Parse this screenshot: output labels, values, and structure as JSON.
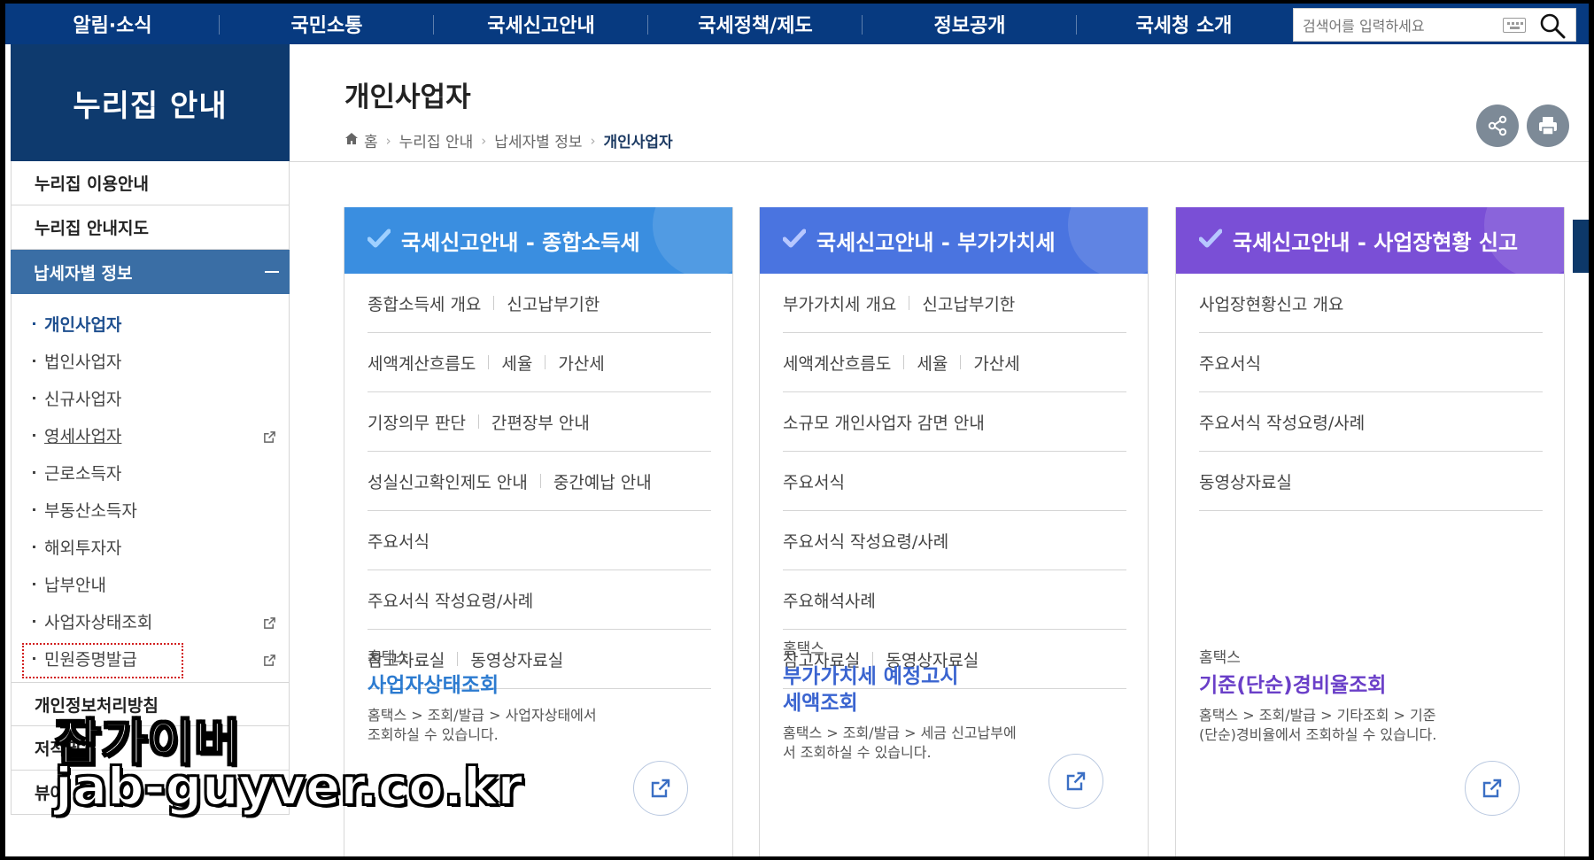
{
  "nav": {
    "items": [
      "알림·소식",
      "국민소통",
      "국세신고안내",
      "국세정책/제도",
      "정보공개",
      "국세청 소개"
    ],
    "search_placeholder": "검색어를 입력하세요"
  },
  "sidebar": {
    "title": "누리집 안내",
    "top_links": [
      "누리집 이용안내",
      "누리집 안내지도"
    ],
    "active": "납세자별 정보",
    "sub_items": [
      {
        "label": "개인사업자"
      },
      {
        "label": "법인사업자"
      },
      {
        "label": "신규사업자"
      },
      {
        "label": "영세사업자"
      },
      {
        "label": "근로소득자"
      },
      {
        "label": "부동산소득자"
      },
      {
        "label": "해외투자자"
      },
      {
        "label": "납부안내"
      },
      {
        "label": "사업자상태조회"
      },
      {
        "label": "민원증명발급"
      }
    ],
    "bottom_links": [
      "개인정보처리방침",
      "저작권",
      "뷰어"
    ]
  },
  "page": {
    "title": "개인사업자",
    "breadcrumb": [
      "홈",
      "누리집 안내",
      "납세자별 정보",
      "개인사업자"
    ]
  },
  "cards": [
    {
      "title": "국세신고안내 - 종합소득세",
      "color": "#3a8ee0",
      "rows": [
        [
          "종합소득세 개요",
          "신고납부기한"
        ],
        [
          "세액계산흐름도",
          "세율",
          "가산세"
        ],
        [
          "기장의무 판단",
          "간편장부 안내"
        ],
        [
          "성실신고확인제도 안내",
          "중간예납 안내"
        ],
        [
          "주요서식"
        ],
        [
          "주요서식 작성요령/사례"
        ],
        [
          "참고자료실",
          "동영상자료실"
        ]
      ],
      "tile": {
        "caption": "홈택스",
        "title": "사업자상태조회",
        "title_color": "#2c7bd0",
        "desc": "홈택스 > 조회/발급 > 사업자상태에서 조회하실 수 있습니다."
      }
    },
    {
      "title": "국세신고안내 - 부가가치세",
      "color": "#4a74e0",
      "rows": [
        [
          "부가가치세 개요",
          "신고납부기한"
        ],
        [
          "세액계산흐름도",
          "세율",
          "가산세"
        ],
        [
          "소규모 개인사업자 감면 안내"
        ],
        [
          "주요서식"
        ],
        [
          "주요서식 작성요령/사례"
        ],
        [
          "주요해석사례"
        ],
        [
          "참고자료실",
          "동영상자료실"
        ]
      ],
      "tile": {
        "caption": "홈택스",
        "title": "부가가치세 예정고시세액조회",
        "title_color": "#3a64d0",
        "desc": "홈택스 > 조회/발급 > 세금 신고납부에서 조회하실 수 있습니다."
      }
    },
    {
      "title": "국세신고안내 - 사업장현황 신고",
      "color": "#7a4fd6",
      "rows": [
        [
          "사업장현황신고 개요"
        ],
        [
          "주요서식"
        ],
        [
          "주요서식 작성요령/사례"
        ],
        [
          "동영상자료실"
        ]
      ],
      "tile": {
        "caption": "홈택스",
        "title": "기준(단순)경비율조회",
        "title_color": "#6a3fc8",
        "desc": "홈택스 > 조회/발급 > 기타조회 > 기준(단순)경비율에서 조회하실 수 있습니다."
      }
    }
  ],
  "watermark": {
    "line1": "잡가이버",
    "line2": "jab-guyver.co.kr"
  },
  "icons": {
    "share": "share-icon",
    "print": "print-icon",
    "home": "home-icon",
    "external": "external-link-icon",
    "search": "search-icon",
    "keyboard": "keyboard-icon"
  }
}
